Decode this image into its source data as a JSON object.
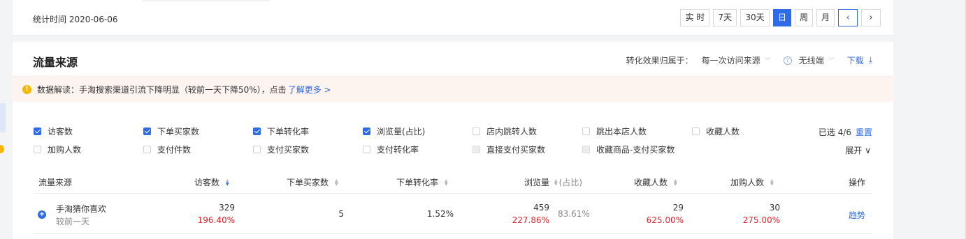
{
  "stat_time": "统计时间 2020-06-06",
  "period_buttons": [
    "实 时",
    "7天",
    "30天",
    "日",
    "周",
    "月"
  ],
  "period_active": "日",
  "nav": {
    "prev": "‹",
    "next": "›"
  },
  "section": {
    "title": "流量来源",
    "attribution_label": "转化效果归属于：",
    "attribution_value": "每一次访问来源",
    "terminal_value": "无线端",
    "download_label": "下载"
  },
  "notice": {
    "text": "数据解读：手淘搜索渠道引流下降明显（较前一天下降50%），点击",
    "link": "了解更多 >"
  },
  "metrics_row1": [
    {
      "label": "访客数",
      "state": "checked"
    },
    {
      "label": "下单买家数",
      "state": "checked"
    },
    {
      "label": "下单转化率",
      "state": "checked"
    },
    {
      "label": "浏览量(占比)",
      "state": "checked"
    },
    {
      "label": "店内跳转人数",
      "state": "unchecked"
    },
    {
      "label": "跳出本店人数",
      "state": "unchecked"
    },
    {
      "label": "收藏人数",
      "state": "unchecked"
    }
  ],
  "metrics_row2": [
    {
      "label": "加购人数",
      "state": "unchecked"
    },
    {
      "label": "支付件数",
      "state": "unchecked"
    },
    {
      "label": "支付买家数",
      "state": "unchecked"
    },
    {
      "label": "支付转化率",
      "state": "unchecked"
    },
    {
      "label": "直接支付买家数",
      "state": "disabled"
    },
    {
      "label": "收藏商品-支付买家数",
      "state": "disabled"
    }
  ],
  "selected": {
    "text": "已选 4/6",
    "reset": "重置"
  },
  "expand_label": "展开 ∨",
  "table": {
    "headers": {
      "source": "流量来源",
      "visitors": "访客数",
      "order_buyers": "下单买家数",
      "order_rate": "下单转化率",
      "pageviews": "浏览量",
      "pageviews_sub": "(占比)",
      "favorites": "收藏人数",
      "cart": "加购人数",
      "action": "操作"
    },
    "row": {
      "name": "手淘猜你喜欢",
      "compare_label": "较前一天",
      "visitors": "329",
      "visitors_change": "196.40%",
      "order_buyers": "5",
      "order_rate": "1.52%",
      "pageviews": "459",
      "pageviews_change": "227.86%",
      "pageviews_ratio": "83.61%",
      "favorites": "29",
      "favorites_change": "625.00%",
      "cart": "30",
      "cart_change": "275.00%",
      "action": "趋势"
    }
  }
}
